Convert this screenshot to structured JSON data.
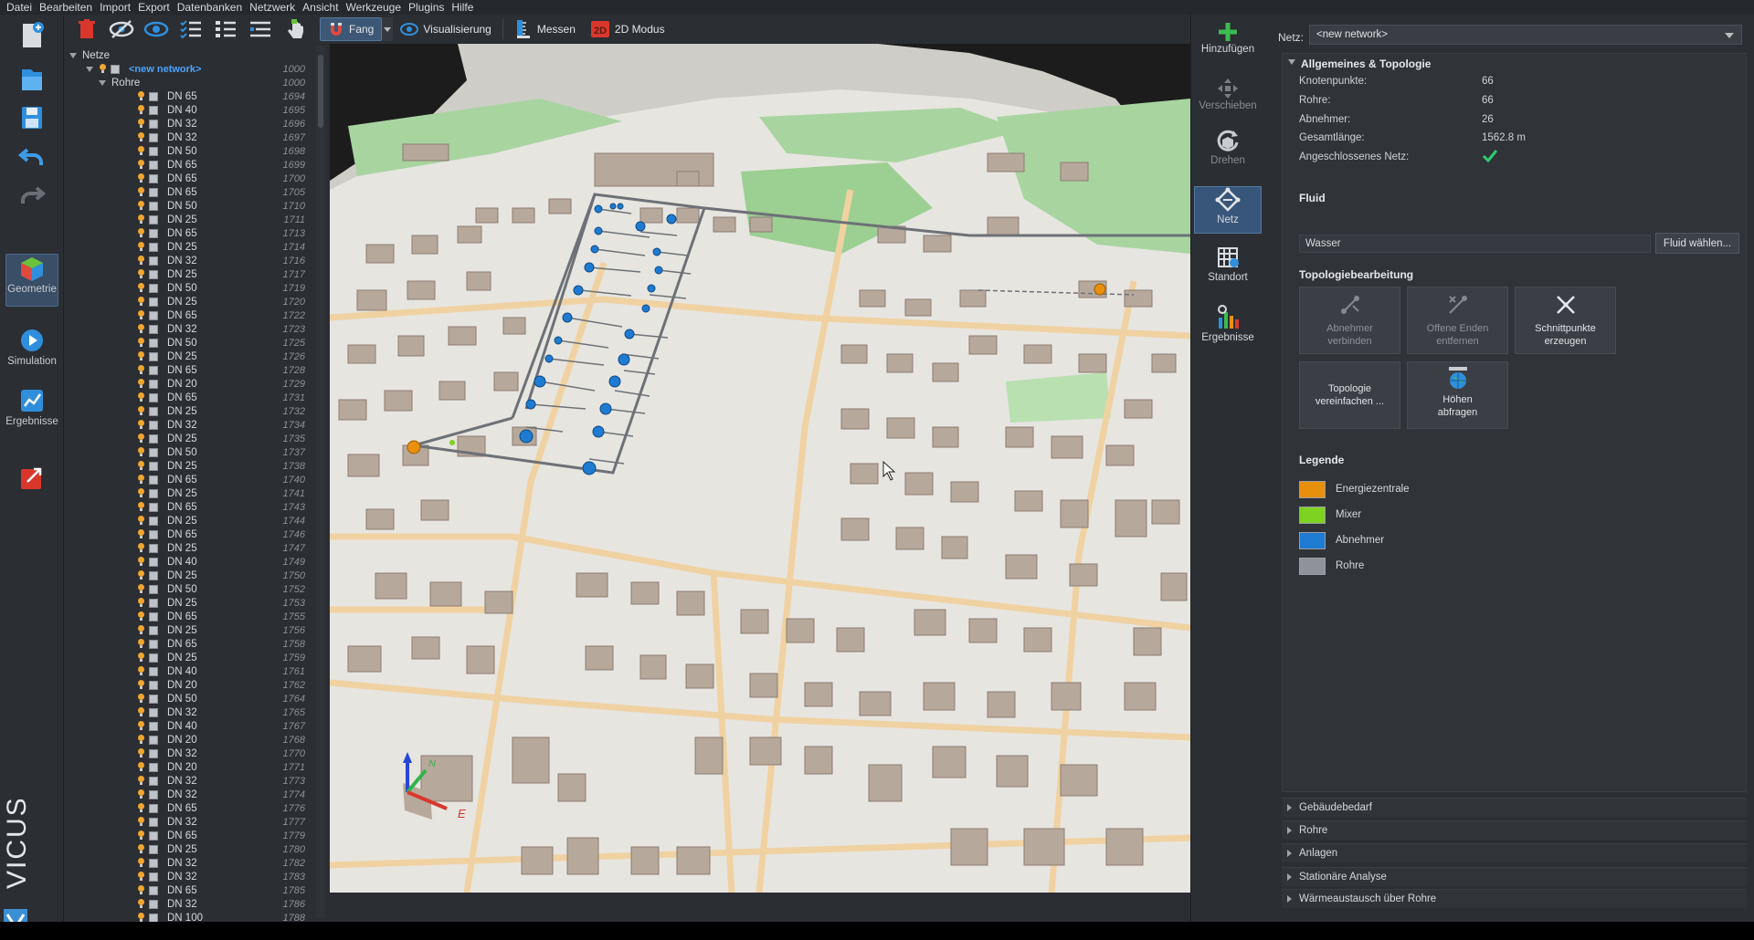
{
  "menu": [
    "Datei",
    "Bearbeiten",
    "Import",
    "Export",
    "Datenbanken",
    "Netzwerk",
    "Ansicht",
    "Werkzeuge",
    "Plugins",
    "Hilfe"
  ],
  "modebar": {
    "items": [
      {
        "label": "Geometrie",
        "active": true
      },
      {
        "label": "Simulation"
      },
      {
        "label": "Ergebnisse"
      }
    ],
    "brand": "VICUS"
  },
  "toolbar": {
    "fang": "Fang",
    "visualisierung": "Visualisierung",
    "messen": "Messen",
    "modus2d": "2D Modus"
  },
  "tree": {
    "root": "Netze",
    "network": {
      "name": "<new network>",
      "num": "1000"
    },
    "group": {
      "name": "Rohre",
      "num": "1000"
    },
    "rows": [
      [
        "DN 65",
        "1694"
      ],
      [
        "DN 40",
        "1695"
      ],
      [
        "DN 32",
        "1696"
      ],
      [
        "DN 32",
        "1697"
      ],
      [
        "DN 50",
        "1698"
      ],
      [
        "DN 65",
        "1699"
      ],
      [
        "DN 65",
        "1700"
      ],
      [
        "DN 65",
        "1705"
      ],
      [
        "DN 50",
        "1710"
      ],
      [
        "DN 25",
        "1711"
      ],
      [
        "DN 65",
        "1713"
      ],
      [
        "DN 25",
        "1714"
      ],
      [
        "DN 32",
        "1716"
      ],
      [
        "DN 25",
        "1717"
      ],
      [
        "DN 50",
        "1719"
      ],
      [
        "DN 25",
        "1720"
      ],
      [
        "DN 65",
        "1722"
      ],
      [
        "DN 32",
        "1723"
      ],
      [
        "DN 50",
        "1725"
      ],
      [
        "DN 25",
        "1726"
      ],
      [
        "DN 65",
        "1728"
      ],
      [
        "DN 20",
        "1729"
      ],
      [
        "DN 65",
        "1731"
      ],
      [
        "DN 25",
        "1732"
      ],
      [
        "DN 32",
        "1734"
      ],
      [
        "DN 25",
        "1735"
      ],
      [
        "DN 50",
        "1737"
      ],
      [
        "DN 25",
        "1738"
      ],
      [
        "DN 65",
        "1740"
      ],
      [
        "DN 25",
        "1741"
      ],
      [
        "DN 65",
        "1743"
      ],
      [
        "DN 25",
        "1744"
      ],
      [
        "DN 65",
        "1746"
      ],
      [
        "DN 25",
        "1747"
      ],
      [
        "DN 40",
        "1749"
      ],
      [
        "DN 25",
        "1750"
      ],
      [
        "DN 50",
        "1752"
      ],
      [
        "DN 25",
        "1753"
      ],
      [
        "DN 65",
        "1755"
      ],
      [
        "DN 25",
        "1756"
      ],
      [
        "DN 65",
        "1758"
      ],
      [
        "DN 25",
        "1759"
      ],
      [
        "DN 40",
        "1761"
      ],
      [
        "DN 20",
        "1762"
      ],
      [
        "DN 50",
        "1764"
      ],
      [
        "DN 32",
        "1765"
      ],
      [
        "DN 40",
        "1767"
      ],
      [
        "DN 20",
        "1768"
      ],
      [
        "DN 32",
        "1770"
      ],
      [
        "DN 20",
        "1771"
      ],
      [
        "DN 32",
        "1773"
      ],
      [
        "DN 32",
        "1774"
      ],
      [
        "DN 65",
        "1776"
      ],
      [
        "DN 32",
        "1777"
      ],
      [
        "DN 65",
        "1779"
      ],
      [
        "DN 25",
        "1780"
      ],
      [
        "DN 32",
        "1782"
      ],
      [
        "DN 32",
        "1783"
      ],
      [
        "DN 65",
        "1785"
      ],
      [
        "DN 32",
        "1786"
      ],
      [
        "DN 100",
        "1788"
      ]
    ]
  },
  "toolcol": {
    "hinzufuegen": "Hinzufügen",
    "verschieben": "Verschieben",
    "drehen": "Drehen",
    "netz": "Netz",
    "standort": "Standort",
    "ergebnisse": "Ergebnisse"
  },
  "props": {
    "net_label": "Netz:",
    "net_value": "<new network>",
    "general_title": "Allgemeines & Topologie",
    "general": [
      {
        "k": "Knotenpunkte:",
        "v": "66"
      },
      {
        "k": "Rohre:",
        "v": "66"
      },
      {
        "k": "Abnehmer:",
        "v": "26"
      },
      {
        "k": "Gesamtlänge:",
        "v": "1562.8 m"
      },
      {
        "k": "Angeschlossenes Netz:",
        "v": ""
      }
    ],
    "fluid_title": "Fluid",
    "fluid_value": "Wasser",
    "fluid_button": "Fluid wählen...",
    "topo_title": "Topologiebearbeitung",
    "topo_buttons": [
      {
        "l1": "Abnehmer",
        "l2": "verbinden"
      },
      {
        "l1": "Offene Enden",
        "l2": "entfernen"
      },
      {
        "l1": "Schnittpunkte",
        "l2": "erzeugen"
      },
      {
        "l1": "Topologie",
        "l2": "vereinfachen ..."
      },
      {
        "l1": "Höhen",
        "l2": "abfragen"
      }
    ],
    "legend_title": "Legende",
    "legend": [
      {
        "label": "Energiezentrale",
        "color": "#e8900e"
      },
      {
        "label": "Mixer",
        "color": "#7ed321"
      },
      {
        "label": "Abnehmer",
        "color": "#1f7bd1"
      },
      {
        "label": "Rohre",
        "color": "#8f9399"
      }
    ],
    "collapsed": [
      "Gebäudebedarf",
      "Rohre",
      "Anlagen",
      "Stationäre Analyse",
      "Wärmeaustausch über Rohre"
    ]
  },
  "colors": {
    "accent": "#3d5876",
    "check": "#2ecc71"
  }
}
